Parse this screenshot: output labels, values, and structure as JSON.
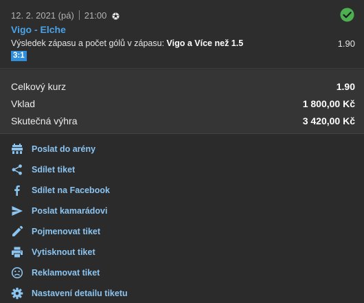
{
  "bet": {
    "date": "12. 2. 2021 (pá)",
    "time": "21:00",
    "sport_icon": "football-icon",
    "status_icon": "check-circle-icon",
    "status_color": "#4caf50",
    "match": "Vigo - Elche",
    "market_prefix": "Výsledek zápasu a počet gólů v zápasu: ",
    "selection": "Vigo a Více než 1.5",
    "odds": "1.90",
    "score": "3:1"
  },
  "summary": {
    "rows": [
      {
        "label": "Celkový kurz",
        "value": "1.90"
      },
      {
        "label": "Vklad",
        "value": "1 800,00 Kč"
      },
      {
        "label": "Skutečná výhra",
        "value": "3 420,00 Kč"
      }
    ]
  },
  "actions": [
    {
      "label": "Poslat do arény",
      "icon": "arena-icon"
    },
    {
      "label": "Sdílet tiket",
      "icon": "share-icon"
    },
    {
      "label": "Sdílet na Facebook",
      "icon": "facebook-icon"
    },
    {
      "label": "Poslat kamarádovi",
      "icon": "send-icon"
    },
    {
      "label": "Pojmenovat tiket",
      "icon": "pencil-icon"
    },
    {
      "label": "Vytisknout tiket",
      "icon": "printer-icon"
    },
    {
      "label": "Reklamovat tiket",
      "icon": "sad-face-icon"
    },
    {
      "label": "Nastavení detailu tiketu",
      "icon": "gear-icon"
    }
  ],
  "colors": {
    "accent": "#4aa3e8",
    "link": "#8cc4f0",
    "badge": "#2f8fdc",
    "success": "#4caf50"
  }
}
